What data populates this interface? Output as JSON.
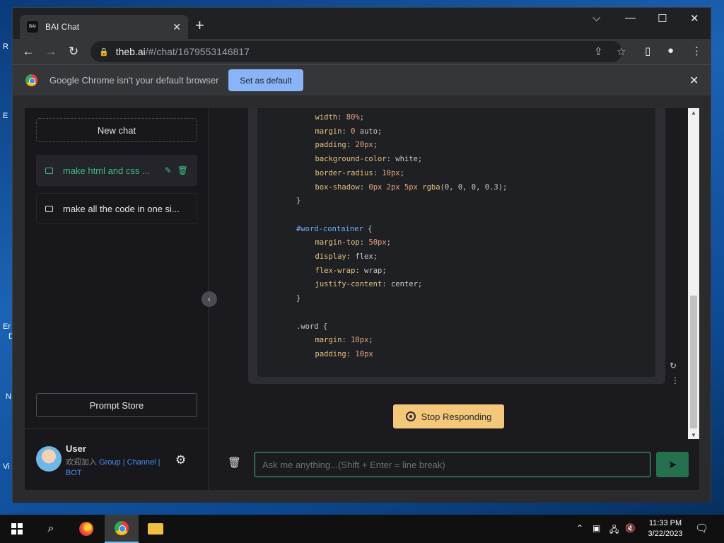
{
  "desktop": {
    "fragments": [
      "R",
      "E",
      "Er",
      "D",
      "N",
      "Vi"
    ]
  },
  "browser": {
    "tab_title": "BAI Chat",
    "tab_favicon_text": "BAI",
    "url_host": "theb.ai",
    "url_path": "/#/chat/1679553146817",
    "infobar_text": "Google Chrome isn't your default browser",
    "set_default_label": "Set as default"
  },
  "sidebar": {
    "new_chat_label": "New chat",
    "chats": [
      {
        "label": "make html and css ..."
      },
      {
        "label": "make all the code in one si..."
      }
    ],
    "prompt_store_label": "Prompt Store",
    "user": {
      "name": "User",
      "desc_prefix": "欢迎加入 ",
      "link_group": "Group",
      "sep1": " | ",
      "link_channel": "Channel",
      "sep2": " | ",
      "link_bot": "BOT"
    }
  },
  "code_lines": [
    {
      "indent": 2,
      "parts": [
        [
          "prop",
          "width"
        ],
        [
          "plain",
          ": "
        ],
        [
          "num",
          "80%"
        ],
        [
          "plain",
          ";"
        ]
      ]
    },
    {
      "indent": 2,
      "parts": [
        [
          "prop",
          "margin"
        ],
        [
          "plain",
          ": "
        ],
        [
          "num",
          "0"
        ],
        [
          "plain",
          " auto;"
        ]
      ]
    },
    {
      "indent": 2,
      "parts": [
        [
          "prop",
          "padding"
        ],
        [
          "plain",
          ": "
        ],
        [
          "num",
          "20px"
        ],
        [
          "plain",
          ";"
        ]
      ]
    },
    {
      "indent": 2,
      "parts": [
        [
          "prop",
          "background-color"
        ],
        [
          "plain",
          ": white;"
        ]
      ]
    },
    {
      "indent": 2,
      "parts": [
        [
          "prop",
          "border-radius"
        ],
        [
          "plain",
          ": "
        ],
        [
          "num",
          "10px"
        ],
        [
          "plain",
          ";"
        ]
      ]
    },
    {
      "indent": 2,
      "parts": [
        [
          "prop",
          "box-shadow"
        ],
        [
          "plain",
          ": "
        ],
        [
          "num",
          "0px 2px 5px"
        ],
        [
          "plain",
          " "
        ],
        [
          "fn",
          "rgba"
        ],
        [
          "plain",
          "(0, 0, 0, 0.3);"
        ]
      ]
    },
    {
      "indent": 1,
      "parts": [
        [
          "plain",
          "}"
        ]
      ]
    },
    {
      "indent": 1,
      "parts": []
    },
    {
      "indent": 1,
      "parts": [
        [
          "sel",
          "#word-container"
        ],
        [
          "plain",
          " {"
        ]
      ]
    },
    {
      "indent": 2,
      "parts": [
        [
          "prop",
          "margin-top"
        ],
        [
          "plain",
          ": "
        ],
        [
          "num",
          "50px"
        ],
        [
          "plain",
          ";"
        ]
      ]
    },
    {
      "indent": 2,
      "parts": [
        [
          "prop",
          "display"
        ],
        [
          "plain",
          ": flex;"
        ]
      ]
    },
    {
      "indent": 2,
      "parts": [
        [
          "prop",
          "flex-wrap"
        ],
        [
          "plain",
          ": wrap;"
        ]
      ]
    },
    {
      "indent": 2,
      "parts": [
        [
          "prop",
          "justify-content"
        ],
        [
          "plain",
          ": center;"
        ]
      ]
    },
    {
      "indent": 1,
      "parts": [
        [
          "plain",
          "}"
        ]
      ]
    },
    {
      "indent": 1,
      "parts": []
    },
    {
      "indent": 1,
      "parts": [
        [
          "plain",
          ".word {"
        ]
      ]
    },
    {
      "indent": 2,
      "parts": [
        [
          "prop",
          "margin"
        ],
        [
          "plain",
          ": "
        ],
        [
          "num",
          "10px"
        ],
        [
          "plain",
          ";"
        ]
      ]
    },
    {
      "indent": 2,
      "parts": [
        [
          "prop",
          "padding"
        ],
        [
          "plain",
          ": "
        ],
        [
          "num",
          "10px"
        ]
      ]
    }
  ],
  "main": {
    "stop_label": "Stop Responding",
    "input_placeholder": "Ask me anything...(Shift + Enter = line break)"
  },
  "taskbar": {
    "time": "11:33 PM",
    "date": "3/22/2023"
  },
  "colors": {
    "accent": "#3dbb80",
    "stop_button": "#f4c77a",
    "link": "#4a8ef0"
  }
}
